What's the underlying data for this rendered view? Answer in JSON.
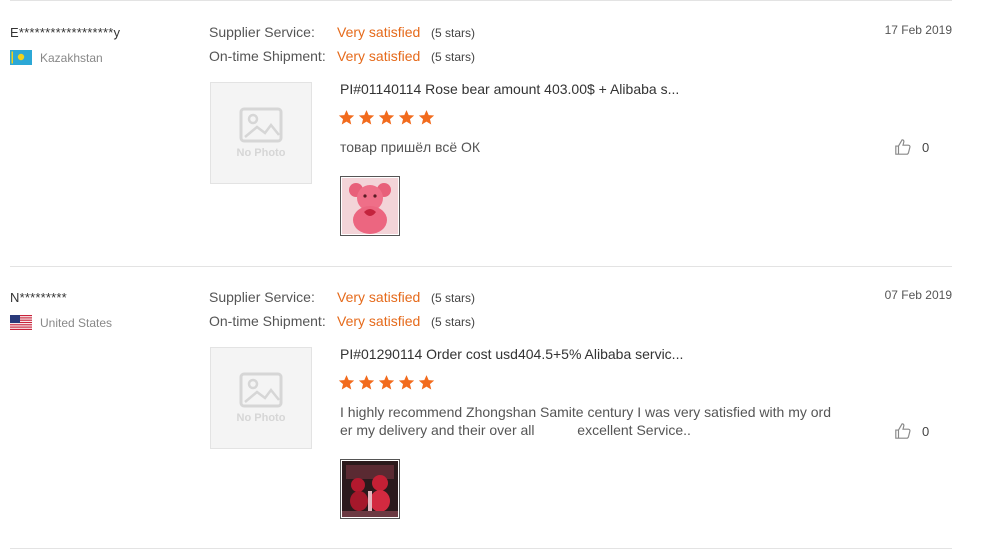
{
  "labels": {
    "supplier_service": "Supplier Service:",
    "ontime_shipment": "On-time Shipment:",
    "no_photo": "No Photo"
  },
  "colors": {
    "accent": "#e56a1b",
    "star": "#f26b1d"
  },
  "reviews": [
    {
      "buyer_name": "E******************y",
      "country": "Kazakhstan",
      "flag_icon": "kazakhstan-flag-icon",
      "date": "17 Feb 2019",
      "supplier_value": "Very satisfied",
      "supplier_stars": "(5 stars)",
      "shipment_value": "Very satisfied",
      "shipment_stars": "(5 stars)",
      "product_title": "PI#01140114 Rose bear amount 403.00$ + Alibaba s...",
      "rating": 5,
      "text": "товар пришёл всё ОК",
      "likes": "0"
    },
    {
      "buyer_name": "N*********",
      "country": "United States",
      "flag_icon": "united-states-flag-icon",
      "date": "07 Feb 2019",
      "supplier_value": "Very satisfied",
      "supplier_stars": "(5 stars)",
      "shipment_value": "Very satisfied",
      "shipment_stars": "(5 stars)",
      "product_title": "PI#01290114 Order cost usd404.5+5% Alibaba servic...",
      "rating": 5,
      "text": "I highly recommend Zhongshan Samite century I was very satisfied with my order my delivery and their over all           excellent Service..",
      "likes": "0"
    }
  ]
}
